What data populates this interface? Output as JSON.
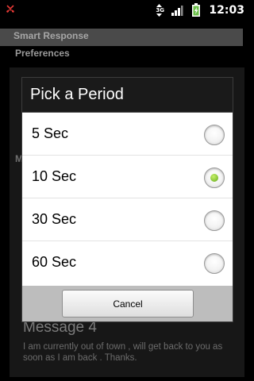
{
  "status_bar": {
    "network_label": "3G",
    "time": "12:03",
    "icons": [
      "missed-call-icon",
      "data-transfer-icon",
      "signal-icon",
      "battery-charging-icon"
    ]
  },
  "background_app": {
    "title": "Smart Response",
    "section": "Preferences",
    "partial_label": "M",
    "message_title": "Message 4",
    "message_body": "I am currently out of town , will get back to you as soon as I am back . Thanks."
  },
  "dialog": {
    "title": "Pick a Period",
    "options": [
      {
        "label": "5 Sec",
        "selected": false
      },
      {
        "label": "10 Sec",
        "selected": true
      },
      {
        "label": "30 Sec",
        "selected": false
      },
      {
        "label": "60 Sec",
        "selected": false
      }
    ],
    "cancel_label": "Cancel"
  },
  "colors": {
    "selected_radio": "#8ac73a",
    "dialog_title_bg": "#1a1a1a"
  }
}
